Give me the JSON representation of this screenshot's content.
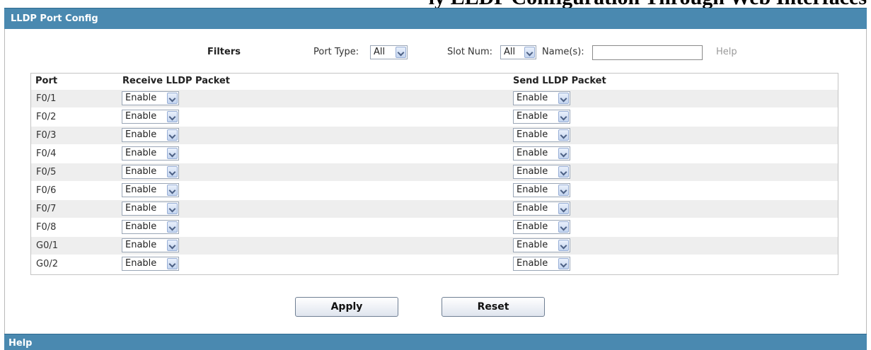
{
  "clipped_heading": "ly LLDP Configuration Through Web Interfaces",
  "panel": {
    "title": "LLDP Port Config"
  },
  "filters": {
    "title": "Filters",
    "port_type_label": "Port Type:",
    "port_type_value": "All",
    "slot_num_label": "Slot Num:",
    "slot_num_value": "All",
    "name_label": "Name(s):",
    "name_value": "",
    "help_label": "Help"
  },
  "table": {
    "headers": {
      "port": "Port",
      "receive": "Receive LLDP Packet",
      "send": "Send LLDP Packet"
    },
    "rows": [
      {
        "port": "F0/1",
        "receive": "Enable",
        "send": "Enable"
      },
      {
        "port": "F0/2",
        "receive": "Enable",
        "send": "Enable"
      },
      {
        "port": "F0/3",
        "receive": "Enable",
        "send": "Enable"
      },
      {
        "port": "F0/4",
        "receive": "Enable",
        "send": "Enable"
      },
      {
        "port": "F0/5",
        "receive": "Enable",
        "send": "Enable"
      },
      {
        "port": "F0/6",
        "receive": "Enable",
        "send": "Enable"
      },
      {
        "port": "F0/7",
        "receive": "Enable",
        "send": "Enable"
      },
      {
        "port": "F0/8",
        "receive": "Enable",
        "send": "Enable"
      },
      {
        "port": "G0/1",
        "receive": "Enable",
        "send": "Enable"
      },
      {
        "port": "G0/2",
        "receive": "Enable",
        "send": "Enable"
      }
    ]
  },
  "buttons": {
    "apply": "Apply",
    "reset": "Reset"
  },
  "help_bar": {
    "title": "Help"
  },
  "colors": {
    "header_bar": "#4a89b0",
    "row_alt": "#eeeeee",
    "help_link": "#9a9a9a"
  },
  "icons": {
    "select_arrow": "chevron-down-icon"
  }
}
